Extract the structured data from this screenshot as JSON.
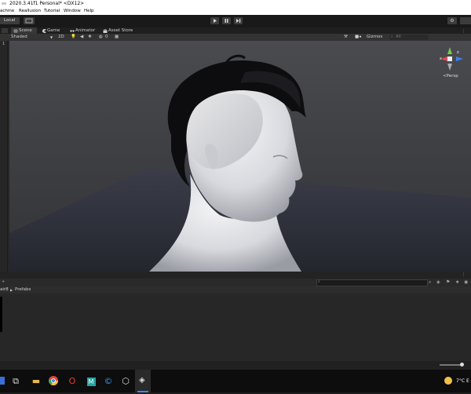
{
  "window": {
    "title": "2020.3.41f1 Personal* <DX12>"
  },
  "menu": {
    "items": [
      "achine",
      "Reallusion",
      "Tutorial",
      "Window",
      "Help"
    ]
  },
  "toolbar": {
    "local_label": "Local"
  },
  "tabs": [
    {
      "label": "Scene",
      "icon": "grid-icon",
      "active": true
    },
    {
      "label": "Game",
      "icon": "pacman-icon"
    },
    {
      "label": "Animator",
      "icon": "animator-icon"
    },
    {
      "label": "Asset Store",
      "icon": "bag-icon"
    }
  ],
  "scene_toolbar": {
    "shading_mode": "Shaded",
    "mode_2d": "2D",
    "overlay_count": "0",
    "gizmos_label": "Gizmos",
    "search_placeholder": "All"
  },
  "left_panel": {
    "number": "1"
  },
  "gizmo": {
    "x_label": "x",
    "z_label": "z",
    "projection": "Persp"
  },
  "project": {
    "breadcrumb_root": "air8",
    "breadcrumb_folder": "Prefabs"
  },
  "system": {
    "temperature": "7°C",
    "tray_extra": "E"
  },
  "colors": {
    "accent_blue": "#2f8ff2",
    "gizmo_red": "#e24a4a",
    "gizmo_green": "#78c84c",
    "gizmo_blue": "#3f7ef0"
  }
}
